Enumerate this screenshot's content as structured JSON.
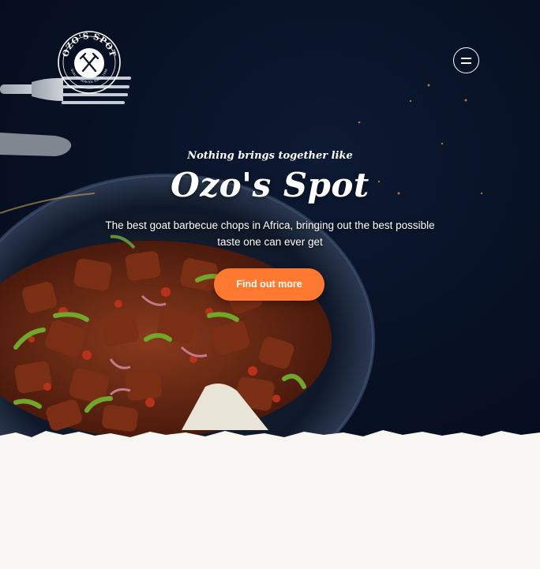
{
  "brand": {
    "logo_text": "OZO'S SPOT",
    "logo_subtext": "QUALITY SERVICE SINCE 1999"
  },
  "nav": {
    "menu_icon": "hamburger-menu-icon"
  },
  "hero": {
    "tagline": "Nothing brings together like",
    "title": "Ozo's Spot",
    "description": "The best goat barbecue chops in Africa, bringing out the best possible taste one can ever get",
    "cta_label": "Find out more"
  },
  "colors": {
    "hero_background": "#081226",
    "accent": "#ff7a30",
    "text": "#ffffff",
    "page_background": "#f7f6f3"
  }
}
